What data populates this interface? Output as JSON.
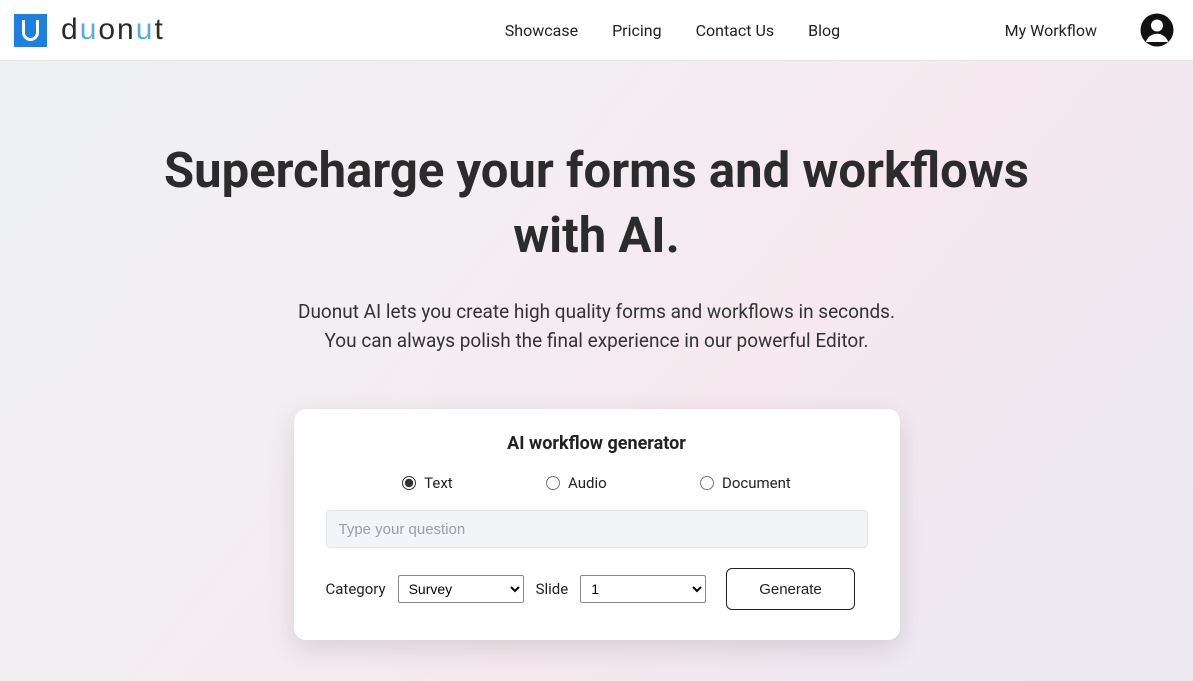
{
  "header": {
    "logo_text_pre": "d",
    "logo_text_blue": "u",
    "logo_text_mid1": "on",
    "logo_text_blue2": "u",
    "logo_text_end": "t",
    "nav": {
      "showcase": "Showcase",
      "pricing": "Pricing",
      "contact": "Contact Us",
      "blog": "Blog"
    },
    "my_workflow": "My Workflow"
  },
  "hero": {
    "title": "Supercharge your forms and workflows with AI.",
    "sub1": "Duonut AI lets you create high quality forms and workflows in seconds.",
    "sub2": "You can always polish the final experience in our powerful Editor."
  },
  "card": {
    "title": "AI workflow generator",
    "radios": {
      "text": "Text",
      "audio": "Audio",
      "document": "Document"
    },
    "question_placeholder": "Type your question",
    "category_label": "Category",
    "category_value": "Survey",
    "slide_label": "Slide",
    "slide_value": "1",
    "generate": "Generate"
  }
}
